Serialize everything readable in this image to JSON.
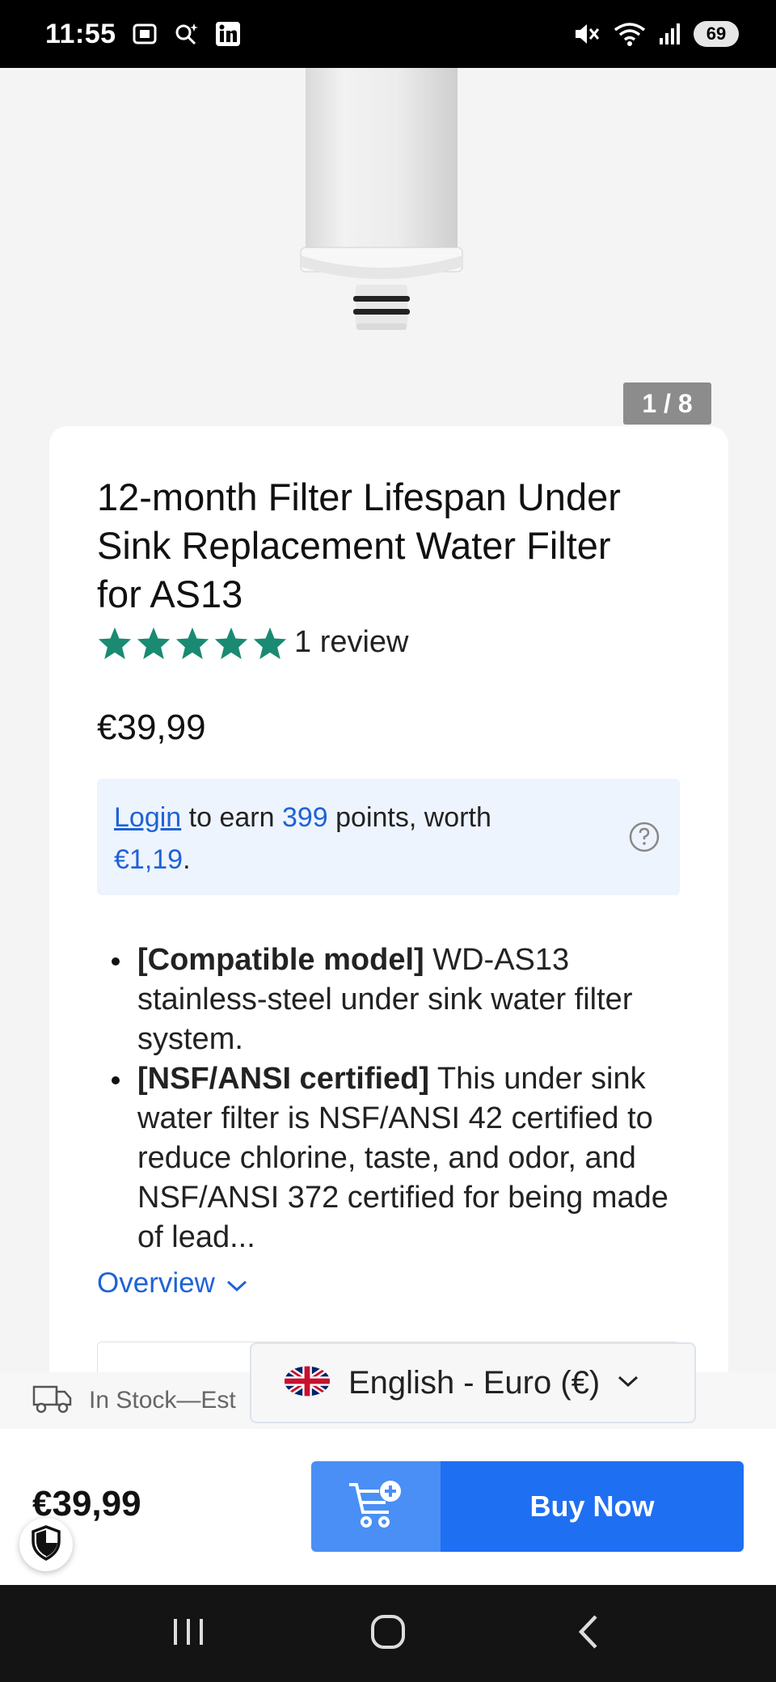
{
  "status_bar": {
    "time": "11:55",
    "battery": "69",
    "icons": [
      "screenshot-icon",
      "search-sparkle-icon",
      "linkedin-icon",
      "mute-icon",
      "wifi-icon",
      "signal-icon",
      "battery-icon"
    ]
  },
  "gallery": {
    "counter": "1 / 8",
    "image": "water-filter-cartridge-image"
  },
  "product": {
    "title": "12-month Filter Lifespan Under Sink Replacement Water Filter for AS13",
    "rating_stars": 5,
    "review_count": "1 review",
    "price": "€39,99",
    "star_color": "#1a8a72"
  },
  "points": {
    "login_label": "Login",
    "text_1": " to earn ",
    "points_value": "399",
    "text_2": " points, worth ",
    "worth_value": "€1,19",
    "text_3": ".",
    "help_icon": "question-circle-icon"
  },
  "bullets": [
    {
      "bold": "[Compatible model]",
      "text": " WD-AS13 stainless-steel under sink water filter system."
    },
    {
      "bold": "[NSF/ANSI certified]",
      "text": " This under sink water filter is NSF/ANSI 42 certified to reduce chlorine, taste, and odor, and NSF/ANSI 372 certified for being made of lead..."
    }
  ],
  "overview": {
    "label": "Overview"
  },
  "stock": {
    "text": "In Stock—Est"
  },
  "language": {
    "label": "English - Euro (€)"
  },
  "buybar": {
    "price": "€39,99",
    "buy_label": "Buy Now",
    "accent": "#1f6ff2"
  }
}
